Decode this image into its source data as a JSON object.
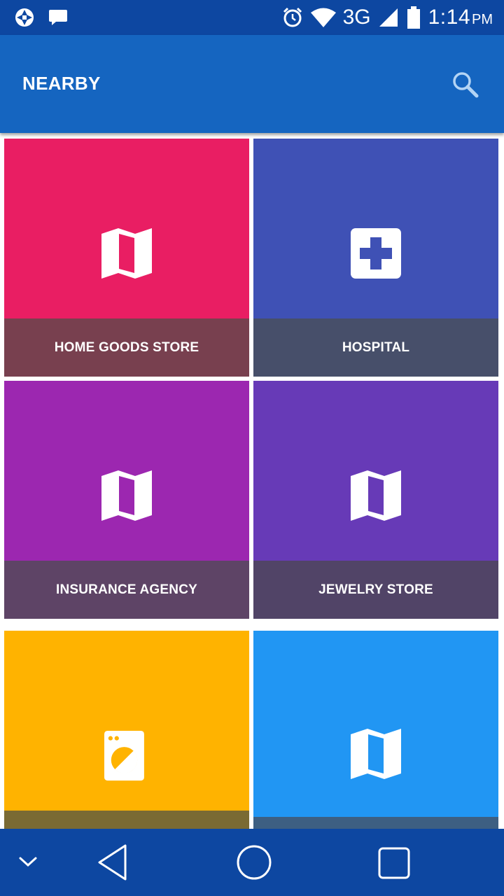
{
  "status_bar": {
    "time": "1:14",
    "ampm": "PM",
    "network": "3G",
    "icons": [
      "aperture-icon",
      "message-icon",
      "alarm-icon",
      "wifi-icon",
      "signal-icon",
      "battery-icon"
    ]
  },
  "app_bar": {
    "title": "NEARBY",
    "search_icon": "search-icon"
  },
  "tiles": [
    {
      "label": "HOME GOODS STORE",
      "color": "#E91E63",
      "label_bg": "#78404F",
      "icon": "map-icon"
    },
    {
      "label": "HOSPITAL",
      "color": "#3F51B5",
      "label_bg": "#474F6A",
      "icon": "hospital-icon"
    },
    {
      "label": "INSURANCE AGENCY",
      "color": "#9C27B0",
      "label_bg": "#5E4466",
      "icon": "map-icon"
    },
    {
      "label": "JEWELRY STORE",
      "color": "#673AB7",
      "label_bg": "#514467",
      "icon": "map-icon"
    },
    {
      "label": "",
      "color": "#FFB300",
      "label_bg": "#7A6A33",
      "icon": "laundry-icon"
    },
    {
      "label": "",
      "color": "#2196F3",
      "label_bg": "#3D5F82",
      "icon": "map-icon"
    }
  ],
  "nav_bar": {
    "icons": [
      "chevron-down-icon",
      "back-icon",
      "home-icon",
      "recents-icon"
    ]
  },
  "colors": {
    "status_bar": "#0D47A1",
    "app_bar": "#1565C0"
  }
}
